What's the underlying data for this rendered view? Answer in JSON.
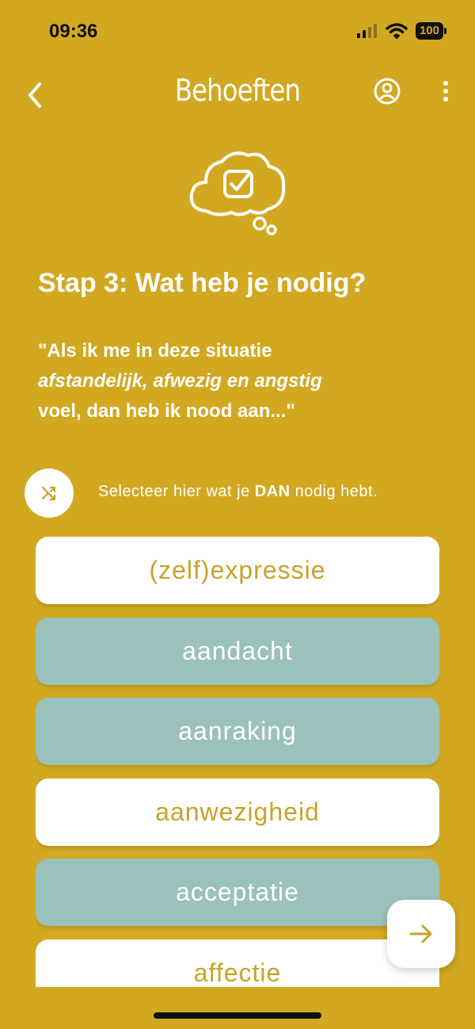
{
  "status_bar": {
    "time": "09:36",
    "battery": "100"
  },
  "header": {
    "title": "Behoeften"
  },
  "icons": {
    "back": "chevron-left-icon",
    "profile": "user-circle-icon",
    "more": "more-vertical-icon",
    "cloud": "thought-cloud-check-icon",
    "shuffle": "shuffle-icon",
    "next": "arrow-right-icon"
  },
  "step": {
    "title": "Stap 3: Wat heb je nodig?"
  },
  "quote": {
    "line1": "\"Als ik me in deze situatie",
    "feelings": "afstandelijk,  afwezig en angstig",
    "line3": "voel, dan heb ik nood aan...\""
  },
  "hint": {
    "before": "Selecteer hier wat je ",
    "bold": "DAN",
    "after": " nodig hebt."
  },
  "needs": [
    {
      "label": "(zelf)expressie",
      "selected": false
    },
    {
      "label": "aandacht",
      "selected": true
    },
    {
      "label": "aanraking",
      "selected": true
    },
    {
      "label": "aanwezigheid",
      "selected": false
    },
    {
      "label": "acceptatie",
      "selected": true
    },
    {
      "label": "affectie",
      "selected": false
    }
  ],
  "colors": {
    "background": "#D2A821",
    "selected": "#9BC1BC",
    "unselected": "#FFFFFF",
    "unselected_text": "#C9A22A"
  }
}
